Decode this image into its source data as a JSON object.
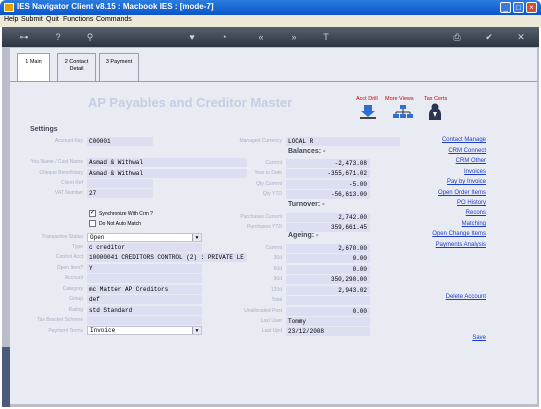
{
  "window": {
    "title": "IES Navigator Client v8.15 : Macbook IES :      [mode-7]"
  },
  "menu": [
    "Help",
    "Submit",
    "Quit",
    "Functions",
    "Commands"
  ],
  "toolbar_icons": [
    "key-icon",
    "help-icon",
    "search-icon",
    "heart-icon",
    "clock-icon",
    "back-icon",
    "forward-icon",
    "text-icon",
    "print-icon",
    "check-icon",
    "close-icon"
  ],
  "tabs": [
    {
      "label": "1 Main"
    },
    {
      "label": "2 Contact Detail"
    },
    {
      "label": "3 Payment"
    }
  ],
  "heading": "AP Payables and Creditor Master",
  "top_links": {
    "acct_drill": "Acct Drill",
    "more_views": "More Views",
    "tax_certs": "Tax Certs"
  },
  "settings_title": "Settings",
  "labels": {
    "account_key": "Account Key",
    "you_name": "You Name / Cust Name",
    "cheque_beneficiary": "Cheque Beneficiary",
    "client_ref": "Client Ref",
    "vat_number": "VAT Number",
    "transaction_status": "Transaction Status",
    "type": "Type",
    "control_acct": "Control Acct",
    "open_item": "Open Item?",
    "account": "Account",
    "category": "Category",
    "group": "Group",
    "rating": "Rating",
    "tax_bracket": "Tax Bracket Scheme",
    "payment_terms": "Payment Terms",
    "managed_currency": "Managed Currency",
    "current": "Current",
    "year_to_date": "Year to Date",
    "qty_current": "Qty Current",
    "qty_ytd": "Qty YTD",
    "purchases_current": "Purchases Current",
    "purchases_ytd": "Purchases YTD",
    "age_current": "Current",
    "age_30": "30d",
    "age_60": "60d",
    "age_90": "90d",
    "age_120": "120d",
    "age_total": "Total",
    "unallocated": "Unallocated Post",
    "last_user": "Last User",
    "last_updated": "Last Upd"
  },
  "values": {
    "account_key": "C00001",
    "you_name": "Asmad & Withwal",
    "cheque_beneficiary": "Asmad & Withwal",
    "client_ref": "",
    "vat_number": "27",
    "sync_crm": "Synchronize With Crm ?",
    "no_auto_match": "Do Not Auto Match",
    "transaction_status": "Open",
    "type": "c creditor",
    "control_acct": "10000041 CREDITORS CONTROL (2) : PRIVATE LE",
    "open_item": "Y",
    "account": "",
    "category": "mc Matter AP Creditors",
    "group": "def",
    "rating": "std Standard",
    "tax_bracket": "",
    "payment_terms": "Invoice",
    "managed_currency": "LOCAL R",
    "current": "-2,473.08",
    "year_to_date": "-355,671.02",
    "qty_current": "-5.00",
    "qty_ytd": "-56,613.00",
    "purchases_current": "2,742.00",
    "purchases_ytd": "359,661.45",
    "age_current": "2,670.00",
    "age_30": "0.00",
    "age_60": "0.00",
    "age_90": "350,290.00",
    "age_120": "2,943.02",
    "age_total": "",
    "unallocated": "0.00",
    "last_user": "Tommy",
    "last_updated": "23/12/2008"
  },
  "sections": {
    "balances": "Balances: -",
    "turnover": "Turnover: -",
    "ageing": "Ageing: -"
  },
  "right_links": [
    "Contact Manage",
    "CRM Connect",
    "CRM Other",
    "Invoices",
    "Pay by Invoice",
    "Open Order Items",
    "PO History",
    "Recons",
    "Matching",
    "Open Change Items",
    "Payments Analysis"
  ],
  "delete_link": "Delete Account",
  "save_link": "Save",
  "colors": {
    "title_blue": "#0a55c8",
    "link_blue": "#1e3cc8",
    "link_red": "#cc0000",
    "content_bg": "#e9ebf3",
    "field_bg": "#dcdff2"
  }
}
